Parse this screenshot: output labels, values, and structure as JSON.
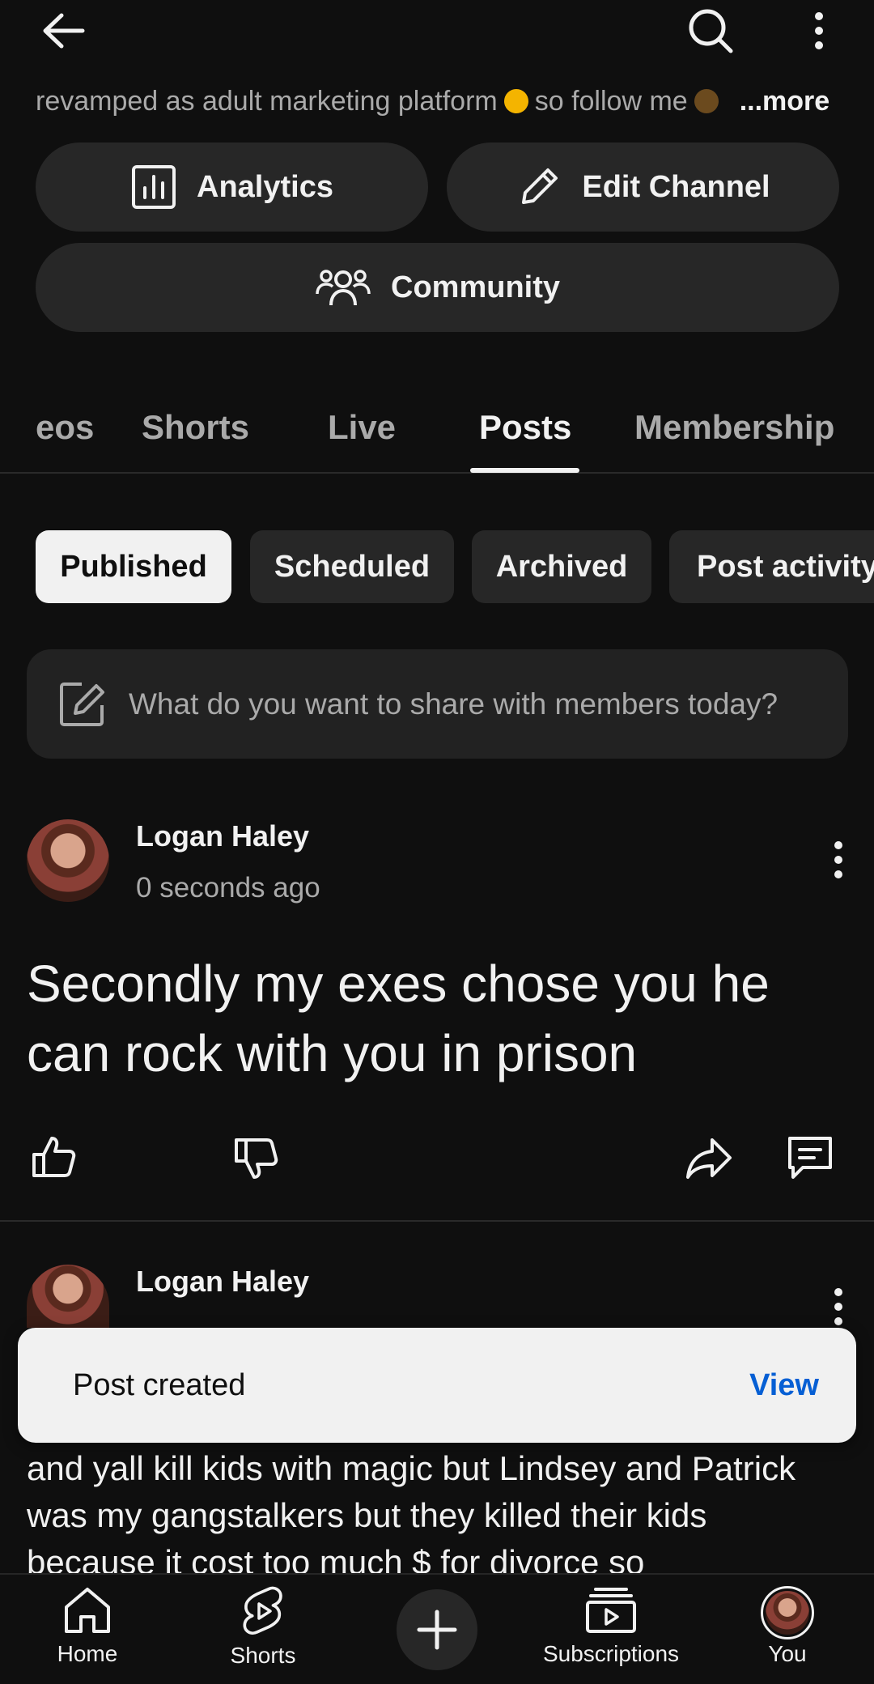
{
  "description": {
    "text": "revamped as adult marketing platform",
    "text2": "so follow me",
    "more": "...more"
  },
  "actions": {
    "analytics": "Analytics",
    "edit_channel": "Edit Channel",
    "community": "Community"
  },
  "tabs": [
    {
      "label": "eos"
    },
    {
      "label": "Shorts"
    },
    {
      "label": "Live"
    },
    {
      "label": "Posts"
    },
    {
      "label": "Membership"
    }
  ],
  "filters": [
    {
      "label": "Published"
    },
    {
      "label": "Scheduled"
    },
    {
      "label": "Archived"
    },
    {
      "label": "Post activity"
    }
  ],
  "composer": {
    "placeholder": "What do you want to share with members today?"
  },
  "posts": [
    {
      "author": "Logan Haley",
      "time": "0 seconds ago",
      "text": "Secondly my exes chose you he can rock with you in prison"
    },
    {
      "author": "Logan Haley",
      "text": "and yall kill kids with magic but Lindsey and Patrick was my gangstalkers but they killed their kids because it cost too much $ for divorce so"
    }
  ],
  "toast": {
    "message": "Post created",
    "action": "View"
  },
  "nav": {
    "home": "Home",
    "shorts": "Shorts",
    "subscriptions": "Subscriptions",
    "you": "You"
  },
  "colors": {
    "background": "#0f0f0f",
    "surface": "#272727",
    "link_blue": "#065fd4"
  }
}
